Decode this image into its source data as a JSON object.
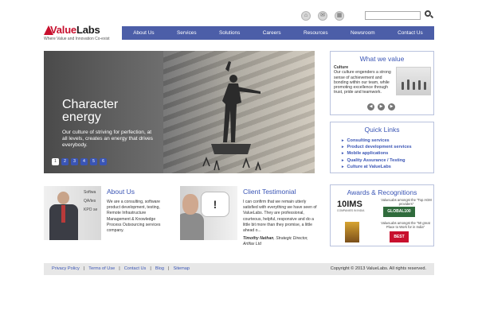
{
  "brand": {
    "name_part1": "Value",
    "name_part2": "Labs",
    "tagline": "Where Value and Innovation Co-exist"
  },
  "header": {
    "icons": [
      "home-icon",
      "mail-icon",
      "sitemap-icon"
    ],
    "search_placeholder": ""
  },
  "nav": {
    "items": [
      "About Us",
      "Services",
      "Solutions",
      "Careers",
      "Resources",
      "Newsroom",
      "Contact Us"
    ]
  },
  "hero": {
    "title": "Character energy",
    "description": "Our culture of striving for perfection, at all levels, creates an energy that drives everybody.",
    "slides": [
      "1",
      "2",
      "3",
      "4",
      "5",
      "6"
    ],
    "active_slide": "1"
  },
  "values_panel": {
    "title": "What we value",
    "heading": "Culture",
    "text": "Our culture engenders a strong sense of achievement and bonding within our team, while promoting excellence through trust, pride and teamwork."
  },
  "quick_links": {
    "title": "Quick Links",
    "items": [
      "Consulting services",
      "Product development services",
      "Mobile applications",
      "Quality Assurance / Testing",
      "Culture at ValueLabs"
    ]
  },
  "awards": {
    "title": "Awards & Recognitions",
    "badge1": "10IMS",
    "badge1_caption": "COMPANIES IN INDIA",
    "text1": "ValueLabs amongst the \"Top AGM providers\"",
    "badge2": "GLOBAL100",
    "text2": "ValueLabs amongst the \"50 great Place to Work for in India\"",
    "badge3": "BEST"
  },
  "about": {
    "title": "About Us",
    "text": "We are a consulting, software product development, testing, Remote Infrastructure Management & Knowledge Process Outsourcing services company.",
    "image_words": [
      "Softwa",
      "QA/tes",
      "KPO se"
    ]
  },
  "testimonial": {
    "title": "Client Testimonial",
    "quote": "I can confirm that we remain utterly satisfied with everything we have seen of ValueLabs. They are professional, courteous, helpful, responsive and do a little bit more than they promise, a little ahead o...",
    "author": "Timothy Nathan",
    "author_role": ", Strategic Director,",
    "company": "Artifax Ltd"
  },
  "footer": {
    "links": [
      "Privacy Policy",
      "Terms of Use",
      "Contact Us",
      "Blog",
      "Sitemap"
    ],
    "separator": "|",
    "copyright": "Copyright © 2013 ValueLabs. All rights reserved."
  },
  "colors": {
    "nav_bg": "#4c5ea8",
    "link_blue": "#3a55b5",
    "brand_red": "#c8102e",
    "footer_bg": "#e7e7e7"
  }
}
